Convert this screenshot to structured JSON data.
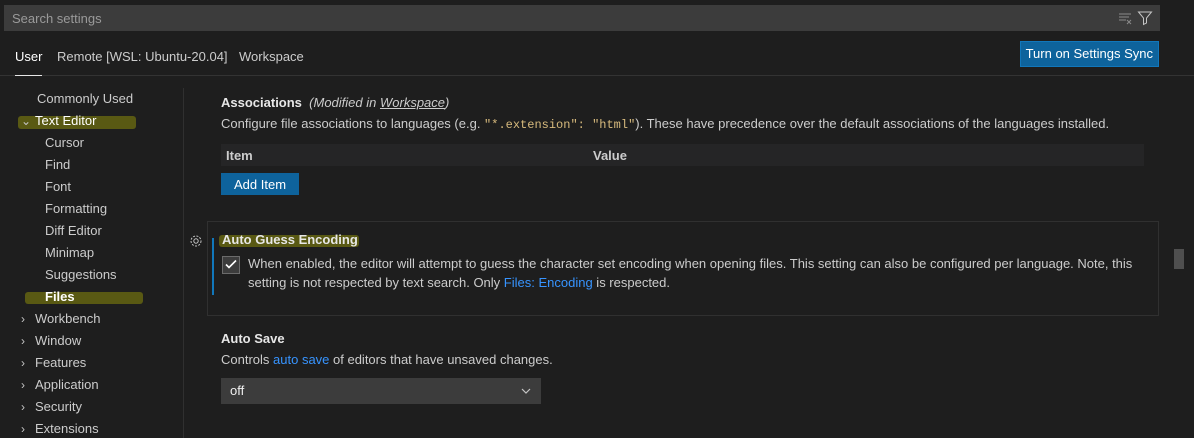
{
  "search": {
    "placeholder": "Search settings"
  },
  "scopes": {
    "user": "User",
    "remote": "Remote [WSL: Ubuntu-20.04]",
    "workspace": "Workspace",
    "sync_button": "Turn on Settings Sync"
  },
  "toc": {
    "commonly_used": "Commonly Used",
    "text_editor": "Text Editor",
    "text_editor_children": [
      "Cursor",
      "Find",
      "Font",
      "Formatting",
      "Diff Editor",
      "Minimap",
      "Suggestions",
      "Files"
    ],
    "collapsed": [
      "Workbench",
      "Window",
      "Features",
      "Application",
      "Security",
      "Extensions"
    ]
  },
  "associations": {
    "title": "Associations",
    "modified_prefix": "(Modified in ",
    "modified_link": "Workspace",
    "modified_suffix": ")",
    "desc_before": "Configure file associations to languages (e.g. ",
    "desc_code": "\"*.extension\": \"html\"",
    "desc_after": "). These have precedence over the default associations of the languages installed.",
    "col_item": "Item",
    "col_value": "Value",
    "add_button": "Add Item"
  },
  "auto_guess": {
    "title": "Auto Guess Encoding",
    "checked": true,
    "desc_line1": "When enabled, the editor will attempt to guess the character set encoding when opening files. This setting can also be configured per language. Note, this",
    "desc_line2_before": "setting is not respected by text search. Only ",
    "desc_link": "Files: Encoding",
    "desc_line2_after": " is respected."
  },
  "auto_save": {
    "title": "Auto Save",
    "desc_before": "Controls ",
    "desc_link": "auto save",
    "desc_after": " of editors that have unsaved changes.",
    "value": "off"
  },
  "colors": {
    "accent": "#0e639c",
    "link": "#3794ff",
    "highlight": "#c8c800"
  }
}
